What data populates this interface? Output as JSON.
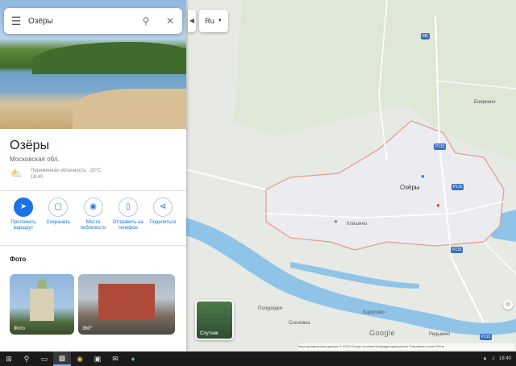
{
  "search": {
    "query": "Озёры"
  },
  "panel": {
    "title": "Озёры",
    "subtitle": "Московская обл.",
    "weather": {
      "line1": "Переменная облачность · 20°C",
      "line2": "18:40"
    },
    "actions": [
      {
        "label": "Проложить маршрут",
        "icon": "directions-icon"
      },
      {
        "label": "Сохранить",
        "icon": "bookmark-icon"
      },
      {
        "label": "Места поблизости",
        "icon": "nearby-icon"
      },
      {
        "label": "Отправить на телефон",
        "icon": "phone-icon"
      },
      {
        "label": "Поделиться",
        "icon": "share-icon"
      }
    ],
    "photos_heading": "Фото",
    "photos": [
      {
        "caption": "Фото"
      },
      {
        "caption": "360°"
      }
    ]
  },
  "map": {
    "lang_button": "Ru",
    "satellite_label": "Спутник",
    "google_logo": "Google",
    "attribution": "Картографические данные © 2020 Google   Условия   Конфиденциальность   Отправить отзыв   200 м",
    "labels": [
      {
        "text": "Озёры"
      },
      {
        "text": "Бояркино"
      },
      {
        "text": "Полурядки"
      },
      {
        "text": "Сосновка"
      },
      {
        "text": "Борисово"
      },
      {
        "text": "Редькино"
      },
      {
        "text": "Клишино"
      }
    ],
    "road_numbers": [
      "М5",
      "Р115",
      "Р115",
      "Р115",
      "Р115"
    ]
  },
  "taskbar": {
    "icons": [
      "windows-icon",
      "search-icon",
      "task-view-icon",
      "explorer-icon",
      "chrome-icon",
      "store-icon",
      "mail-icon",
      "whatsapp-icon"
    ],
    "tray_time": "18:40"
  }
}
